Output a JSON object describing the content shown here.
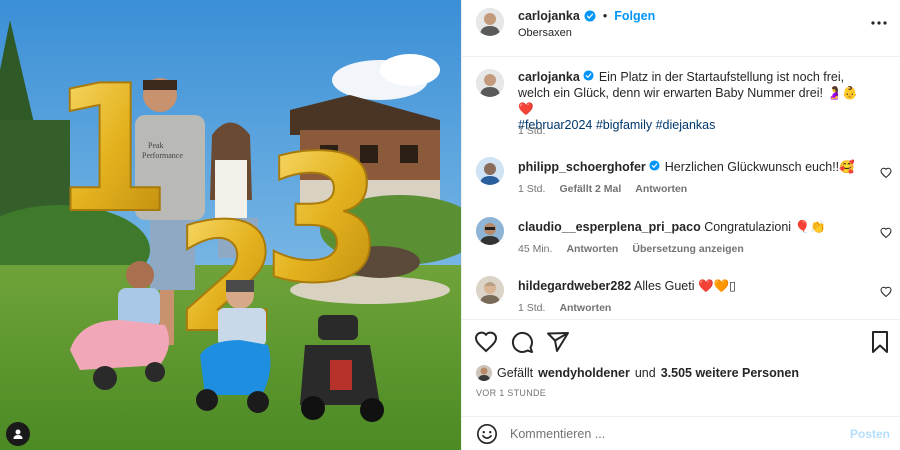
{
  "post": {
    "username": "carlojanka",
    "follow_label": "Folgen",
    "location": "Obersaxen",
    "separator": "•"
  },
  "photo": {
    "shirt_text_1": "Peak",
    "shirt_text_2": "Performance",
    "balloon_digits": [
      "1",
      "2",
      "3"
    ],
    "tag_icon": "user-tag-icon"
  },
  "caption": {
    "username": "carlojanka",
    "text": "Ein Platz in der Startaufstellung ist noch frei, welch ein Glück, denn wir erwarten Baby Nummer drei! 🤰👶❤️",
    "hashtags": "#februar2024 #bigfamily #diejankas",
    "time": "1 Std."
  },
  "comments": [
    {
      "username": "philipp_schoerghofer",
      "verified": true,
      "text": "Herzlichen Glückwunsch euch!!🥰",
      "time": "1 Std.",
      "likes": "Gefällt 2 Mal",
      "reply": "Antworten"
    },
    {
      "username": "claudio__esperplena_pri_paco",
      "verified": false,
      "text": "Congratulazioni 🎈👏",
      "time": "45 Min.",
      "reply": "Antworten",
      "translate": "Übersetzung anzeigen"
    },
    {
      "username": "hildegardweber282",
      "verified": false,
      "text": "Alles Gueti ❤️🧡▯",
      "time": "1 Std.",
      "reply": "Antworten"
    }
  ],
  "likes": {
    "prefix": "Gefällt",
    "user": "wendyholdener",
    "middle": "und",
    "count": "3.505 weitere Personen"
  },
  "timestamp": "VOR 1 STUNDE",
  "comment_box": {
    "placeholder": "Kommentieren ...",
    "post_label": "Posten"
  },
  "colors": {
    "accent": "#0095f6",
    "link": "#00376b",
    "muted": "#737373",
    "balloon_gold": "#e8b923"
  },
  "icons": [
    "heart-icon",
    "comment-icon",
    "share-icon",
    "bookmark-icon",
    "more-icon",
    "emoji-icon",
    "verified-icon"
  ]
}
